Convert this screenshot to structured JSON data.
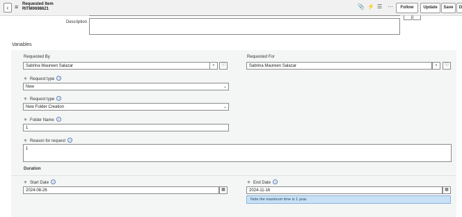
{
  "header": {
    "title": "Requested Item",
    "number": "RITM0698621",
    "buttons": {
      "follow": "Follow",
      "update": "Update",
      "save": "Save",
      "d": "D"
    }
  },
  "description": {
    "label": "Description",
    "value": ""
  },
  "variables": {
    "heading": "Variables"
  },
  "requested_by": {
    "label": "Requested By",
    "value": "Sabrina Maureen Salazar"
  },
  "requested_for": {
    "label": "Requested For",
    "value": "Sabrina Maureen Salazar"
  },
  "request_type_1": {
    "label": "Request type",
    "value": "New"
  },
  "request_type_2": {
    "label": "Request type",
    "value": "New Folder Creation"
  },
  "folder_name": {
    "label": "Folder Name",
    "value": "1"
  },
  "reason": {
    "label": "Reason for request",
    "value": "1"
  },
  "duration": {
    "heading": "Duration"
  },
  "start_date": {
    "label": "Start Date",
    "value": "2024-08-26"
  },
  "end_date": {
    "label": "End Date",
    "value": "2024-11-16",
    "note": "Note the maximum time is 1 year."
  },
  "icons": [
    "back-icon",
    "hamburger-icon",
    "paperclip-icon",
    "activity-icon",
    "settings-icon",
    "more-icon",
    "search-icon",
    "info-icon",
    "calendar-icon",
    "required-icon",
    "help-icon",
    "chevron-down-icon"
  ]
}
